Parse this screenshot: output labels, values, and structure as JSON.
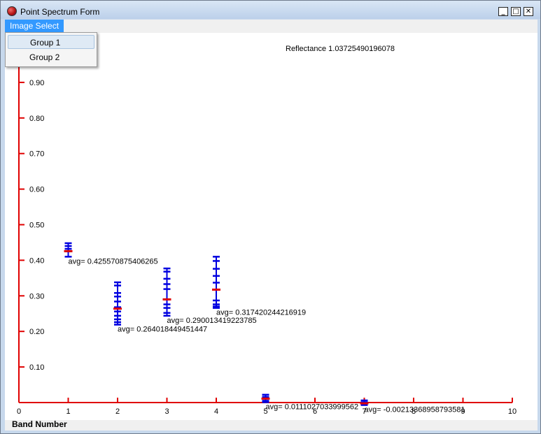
{
  "window": {
    "title": "Point Spectrum Form",
    "minimize_glyph": "_",
    "maximize_glyph": "□",
    "close_glyph": "✕",
    "icon": "app-globe-icon"
  },
  "menu": {
    "image_select_label": "Image Select"
  },
  "dropdown": {
    "items": [
      {
        "label": "Group 1",
        "highlighted": true
      },
      {
        "label": "Group 2",
        "highlighted": false
      }
    ]
  },
  "reflectance_readout": "Reflectance  1.03725490196078",
  "chart_data": {
    "type": "scatter",
    "xlabel": "Band Number",
    "ylabel": "",
    "xlim": [
      0,
      10
    ],
    "ylim": [
      0,
      1.0
    ],
    "x_ticks": [
      "0",
      "1",
      "2",
      "3",
      "4",
      "5",
      "6",
      "7",
      "8",
      "9",
      "10"
    ],
    "y_ticks": [
      "0.10",
      "0.20",
      "0.30",
      "0.40",
      "0.50",
      "0.60",
      "0.70",
      "0.80",
      "0.90"
    ],
    "axis_color": "#e00000",
    "sample_color": "#0000e0",
    "avg_color": "#e00000",
    "bands": [
      {
        "x": 1,
        "samples": [
          0.448,
          0.44,
          0.432,
          0.425,
          0.41
        ],
        "avg": 0.425570875406265,
        "avg_label": "avg= 0.425570875406265"
      },
      {
        "x": 2,
        "samples": [
          0.338,
          0.329,
          0.308,
          0.298,
          0.284,
          0.268,
          0.256,
          0.244,
          0.234,
          0.226,
          0.219
        ],
        "avg": 0.264018449451447,
        "avg_label": "avg= 0.264018449451447"
      },
      {
        "x": 3,
        "samples": [
          0.377,
          0.368,
          0.348,
          0.333,
          0.319,
          0.29,
          0.276,
          0.266,
          0.252,
          0.244
        ],
        "avg": 0.290013419223785,
        "avg_label": "avg= 0.290013419223785"
      },
      {
        "x": 4,
        "samples": [
          0.41,
          0.398,
          0.376,
          0.356,
          0.337,
          0.287,
          0.276,
          0.27,
          0.266
        ],
        "avg": 0.317420244216919,
        "avg_label": "avg= 0.317420244216919"
      },
      {
        "x": 5,
        "samples": [
          0.022,
          0.016,
          0.011,
          0.005,
          0.001
        ],
        "avg": 0.0111027033999562,
        "avg_label": "avg= 0.0111027033999562"
      },
      {
        "x": 7,
        "samples": [
          0.006,
          0.001,
          -0.003,
          -0.007
        ],
        "avg": -0.00213368958793581,
        "avg_label": "avg= -0.00213368958793581"
      }
    ]
  }
}
